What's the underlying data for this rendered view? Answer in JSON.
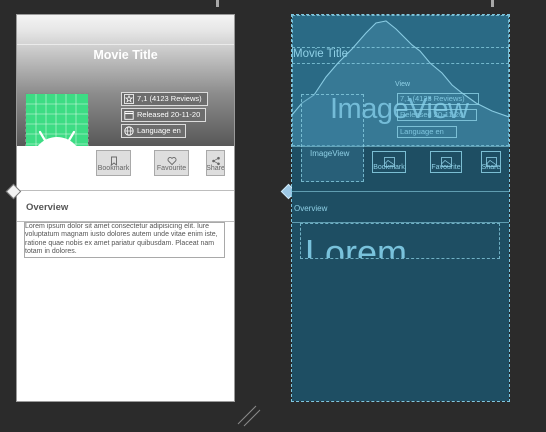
{
  "design": {
    "movie_title": "Movie Title",
    "rating": "7,1 (4123 Reviews)",
    "released": "Released 20-11-20",
    "language": "Language en",
    "actions": {
      "bookmark": "Bookmark",
      "favourite": "Favourite",
      "share": "Share"
    },
    "overview_heading": "Overview",
    "overview_body": "Lorem ipsum dolor sit amet consectetur adipisicing elit. Iure voluptatum magnam iusto dolores autem unde vitae enim iste, ratione quae nobis ex amet pariatur quibusdam. Placeat nam totam in dolores."
  },
  "blueprint": {
    "movie_title": "Movie Title",
    "view_label": "View",
    "imageview_large": "ImageView",
    "imageview_small": "ImageView",
    "rating": "7,1 (4123 Reviews)",
    "released": "Released 20-11-20",
    "language": "Language en",
    "actions": {
      "bookmark": "Bookmark",
      "favourite": "Favourite",
      "share": "Share"
    },
    "overview_heading": "Overview",
    "lorem_large": "Lorem"
  },
  "icons": {
    "rating": "star-icon",
    "released": "calendar-icon",
    "language": "globe-icon",
    "bookmark": "bookmark-icon",
    "favourite": "heart-icon",
    "share": "share-icon",
    "poster": "android-icon"
  },
  "colors": {
    "canvas": "#2b2b2b",
    "blueprint": "#1e4e63",
    "android_green": "#3ddc84"
  }
}
